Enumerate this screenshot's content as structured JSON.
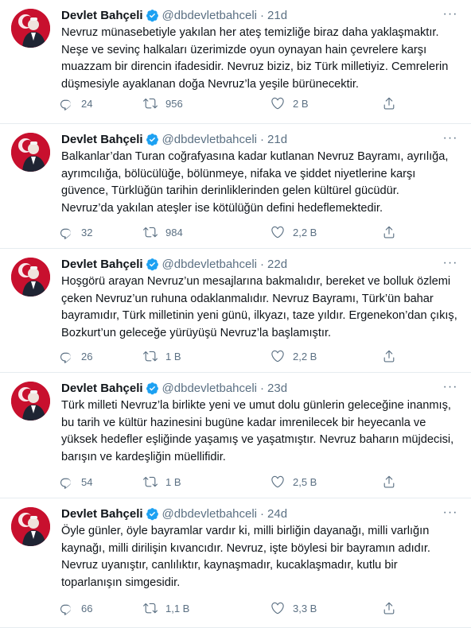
{
  "account": {
    "name": "Devlet Bahçeli",
    "handle": "@dbdevletbahceli",
    "separator": "·",
    "avatar_color": "#c8102e",
    "accent_color": "#1da1f2"
  },
  "tweets": [
    {
      "time": "21d",
      "lines": [
        "Nevruz münasebetiyle yakılan her ateş temizliğe biraz daha yaklaşmaktır.",
        "Neşe ve sevinç halkaları üzerimizde oyun oynayan hain çevrelere karşı",
        "muazzam bir direncin ifadesidir. Nevruz biziz, biz Türk milletiyiz. Cemrelerin",
        "düşmesiyle ayaklanan doğa Nevruz’la yeşile bürünecektir."
      ],
      "replies": "24",
      "retweets": "956",
      "likes": "2 B"
    },
    {
      "time": "21d",
      "lines": [
        "Balkanlar’dan Turan coğrafyasına kadar kutlanan Nevruz Bayramı, ayrılığa,",
        "ayrımcılığa, bölücülüğe, bölünmeye, nifaka ve şiddet niyetlerine karşı",
        "güvence, Türklüğün tarihin derinliklerinden gelen kültürel gücüdür.",
        "Nevruz’da yakılan ateşler ise kötülüğün defini hedeflemektedir."
      ],
      "replies": "32",
      "retweets": "984",
      "likes": "2,2 B"
    },
    {
      "time": "22d",
      "lines": [
        "Hoşgörü arayan Nevruz’un mesajlarına bakmalıdır, bereket ve bolluk özlemi",
        "çeken Nevruz’un ruhuna odaklanmalıdır. Nevruz Bayramı, Türk’ün bahar",
        "bayramıdır, Türk milletinin yeni günü, ilkyazı, taze yıldır. Ergenekon’dan çıkış,",
        "Bozkurt’un geleceğe yürüyüşü Nevruz’la başlamıştır."
      ],
      "replies": "26",
      "retweets": "1 B",
      "likes": "2,2 B"
    },
    {
      "time": "23d",
      "lines": [
        "Türk milleti Nevruz’la birlikte yeni ve umut dolu günlerin geleceğine inanmış,",
        "bu tarih ve kültür hazinesini bugüne kadar imrenilecek bir heyecanla ve",
        "yüksek hedefler eşliğinde yaşamış ve yaşatmıştır. Nevruz baharın müjdecisi,",
        "barışın ve kardeşliğin müellifidir."
      ],
      "replies": "54",
      "retweets": "1 B",
      "likes": "2,5 B"
    },
    {
      "time": "24d",
      "lines": [
        "Öyle günler, öyle bayramlar vardır ki, milli birliğin dayanağı, milli varlığın",
        "kaynağı, milli dirilişin kıvancıdır. Nevruz, işte böylesi bir bayramın adıdır.",
        "Nevruz uyanıştır, canlılıktır, kaynaşmadır, kucaklaşmadır, kutlu bir",
        "toparlanışın simgesidir."
      ],
      "replies": "66",
      "retweets": "1,1 B",
      "likes": "3,3 B"
    }
  ]
}
